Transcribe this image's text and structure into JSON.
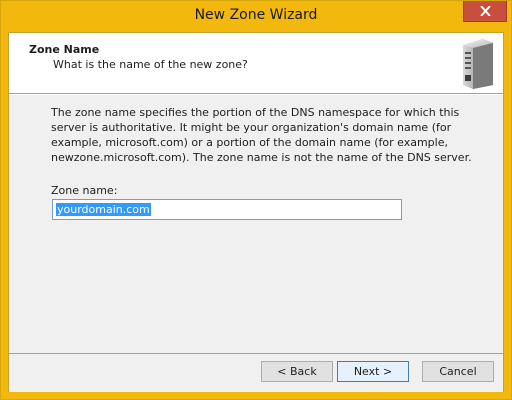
{
  "window": {
    "title": "New Zone Wizard",
    "close_icon": "close-icon"
  },
  "header": {
    "title": "Zone Name",
    "subtitle": "What is the name of the new zone?",
    "icon": "server-icon"
  },
  "body": {
    "description": "The zone name specifies the portion of the DNS namespace for which this server is authoritative. It might be your organization's domain name (for example,  microsoft.com) or a portion of the domain name (for example, newzone.microsoft.com). The zone name is not the name of the DNS server.",
    "zone_label": "Zone name:",
    "zone_value": "yourdomain.com"
  },
  "buttons": {
    "back": "< Back",
    "next": "Next >",
    "cancel": "Cancel"
  },
  "colors": {
    "title_bar": "#f2b80e",
    "close_button": "#c74f3d",
    "selection": "#3399ff"
  }
}
